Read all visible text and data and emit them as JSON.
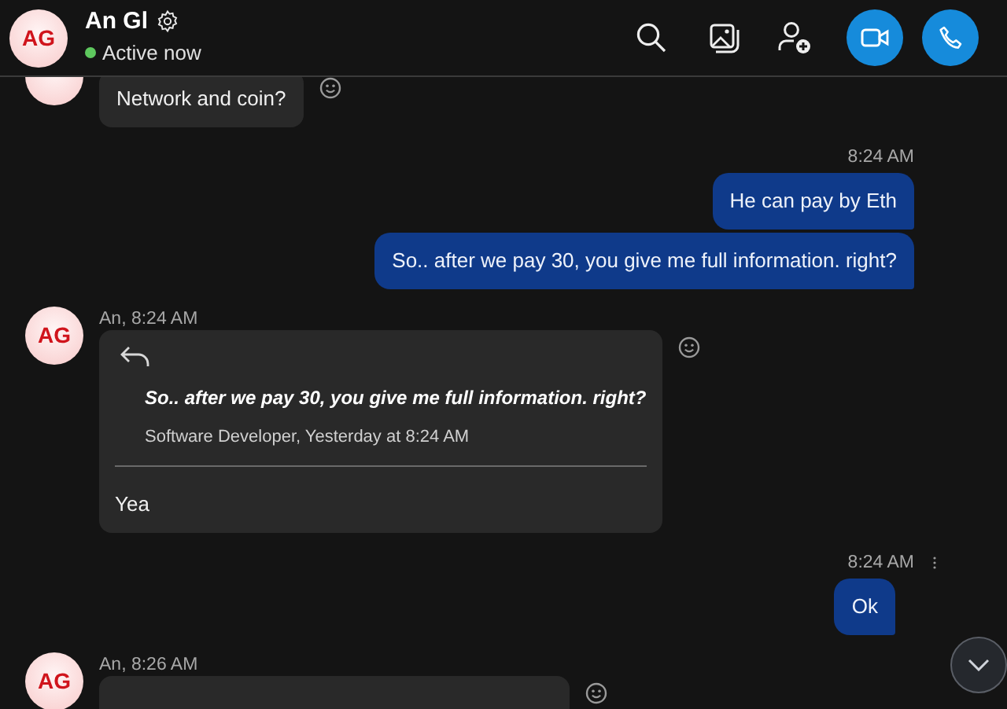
{
  "header": {
    "avatar": "AG",
    "name": "An Gl",
    "status": "Active now",
    "online": true
  },
  "messages": [
    {
      "kind": "incoming",
      "text": "Network and coin?"
    },
    {
      "kind": "outgoing",
      "time": "8:24 AM",
      "text": "He can pay by Eth"
    },
    {
      "kind": "outgoing",
      "text": "So.. after we pay 30, you give me full information. right?"
    },
    {
      "kind": "incoming",
      "avatar": "AG",
      "sender_time": "An, 8:24 AM",
      "quote": {
        "text": "So.. after we pay 30, you give me full information. right?",
        "source": "Software Developer, Yesterday at 8:24 AM"
      },
      "text": "Yea"
    },
    {
      "kind": "outgoing",
      "time": "8:24 AM",
      "text": "Ok",
      "more_menu": true
    },
    {
      "kind": "incoming",
      "avatar": "AG",
      "sender_time": "An, 8:26 AM"
    }
  ]
}
